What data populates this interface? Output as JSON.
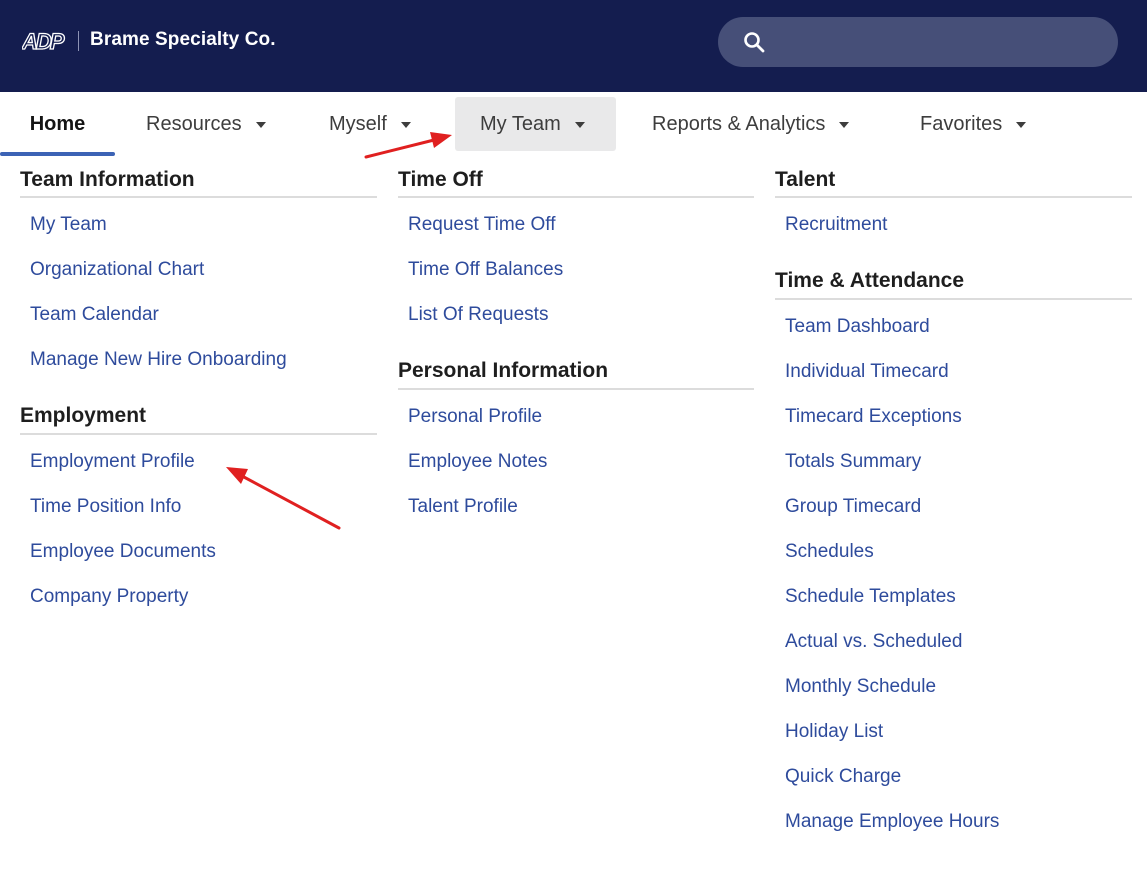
{
  "header": {
    "logo_text": "ADP",
    "company_name": "Brame Specialty Co.",
    "search_placeholder": "",
    "colors": {
      "bar": "#141d4f",
      "search": "#464f78"
    }
  },
  "nav": {
    "home": "Home",
    "resources": "Resources",
    "myself": "Myself",
    "my_team": "My Team",
    "reports": "Reports & Analytics",
    "favorites": "Favorites"
  },
  "menu": {
    "team_information": {
      "title": "Team Information",
      "links": [
        "My Team",
        "Organizational Chart",
        "Team Calendar",
        "Manage New Hire Onboarding"
      ]
    },
    "employment": {
      "title": "Employment",
      "links": [
        "Employment Profile",
        "Time Position Info",
        "Employee Documents",
        "Company Property"
      ]
    },
    "time_off": {
      "title": "Time Off",
      "links": [
        "Request Time Off",
        "Time Off Balances",
        "List Of Requests"
      ]
    },
    "personal_information": {
      "title": "Personal Information",
      "links": [
        "Personal Profile",
        "Employee Notes",
        "Talent Profile"
      ]
    },
    "talent": {
      "title": "Talent",
      "links": [
        "Recruitment"
      ]
    },
    "time_attendance": {
      "title": "Time & Attendance",
      "links": [
        "Team Dashboard",
        "Individual Timecard",
        "Timecard Exceptions",
        "Totals Summary",
        "Group Timecard",
        "Schedules",
        "Schedule Templates",
        "Actual vs. Scheduled",
        "Monthly Schedule",
        "Holiday List",
        "Quick Charge",
        "Manage Employee Hours"
      ]
    },
    "colors": {
      "link": "#2e4b9c",
      "annotation_arrow": "#e02020"
    }
  }
}
